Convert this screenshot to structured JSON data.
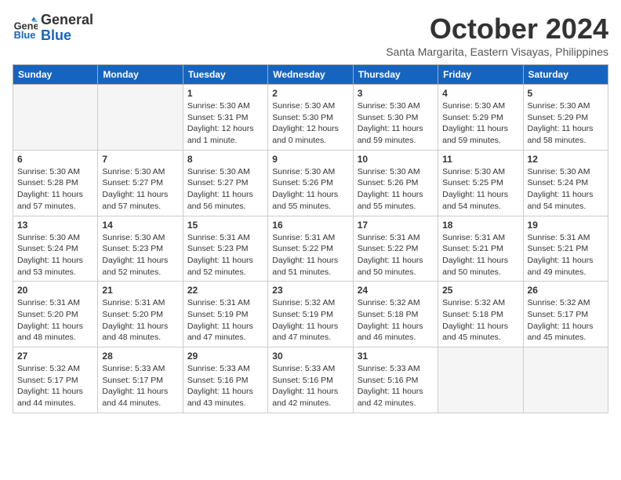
{
  "header": {
    "logo_line1": "General",
    "logo_line2": "Blue",
    "month": "October 2024",
    "location": "Santa Margarita, Eastern Visayas, Philippines"
  },
  "weekdays": [
    "Sunday",
    "Monday",
    "Tuesday",
    "Wednesday",
    "Thursday",
    "Friday",
    "Saturday"
  ],
  "weeks": [
    [
      {
        "day": "",
        "empty": true
      },
      {
        "day": "",
        "empty": true
      },
      {
        "day": "1",
        "sunrise": "5:30 AM",
        "sunset": "5:31 PM",
        "daylight": "12 hours and 1 minute."
      },
      {
        "day": "2",
        "sunrise": "5:30 AM",
        "sunset": "5:30 PM",
        "daylight": "12 hours and 0 minutes."
      },
      {
        "day": "3",
        "sunrise": "5:30 AM",
        "sunset": "5:30 PM",
        "daylight": "11 hours and 59 minutes."
      },
      {
        "day": "4",
        "sunrise": "5:30 AM",
        "sunset": "5:29 PM",
        "daylight": "11 hours and 59 minutes."
      },
      {
        "day": "5",
        "sunrise": "5:30 AM",
        "sunset": "5:29 PM",
        "daylight": "11 hours and 58 minutes."
      }
    ],
    [
      {
        "day": "6",
        "sunrise": "5:30 AM",
        "sunset": "5:28 PM",
        "daylight": "11 hours and 57 minutes."
      },
      {
        "day": "7",
        "sunrise": "5:30 AM",
        "sunset": "5:27 PM",
        "daylight": "11 hours and 57 minutes."
      },
      {
        "day": "8",
        "sunrise": "5:30 AM",
        "sunset": "5:27 PM",
        "daylight": "11 hours and 56 minutes."
      },
      {
        "day": "9",
        "sunrise": "5:30 AM",
        "sunset": "5:26 PM",
        "daylight": "11 hours and 55 minutes."
      },
      {
        "day": "10",
        "sunrise": "5:30 AM",
        "sunset": "5:26 PM",
        "daylight": "11 hours and 55 minutes."
      },
      {
        "day": "11",
        "sunrise": "5:30 AM",
        "sunset": "5:25 PM",
        "daylight": "11 hours and 54 minutes."
      },
      {
        "day": "12",
        "sunrise": "5:30 AM",
        "sunset": "5:24 PM",
        "daylight": "11 hours and 54 minutes."
      }
    ],
    [
      {
        "day": "13",
        "sunrise": "5:30 AM",
        "sunset": "5:24 PM",
        "daylight": "11 hours and 53 minutes."
      },
      {
        "day": "14",
        "sunrise": "5:30 AM",
        "sunset": "5:23 PM",
        "daylight": "11 hours and 52 minutes."
      },
      {
        "day": "15",
        "sunrise": "5:31 AM",
        "sunset": "5:23 PM",
        "daylight": "11 hours and 52 minutes."
      },
      {
        "day": "16",
        "sunrise": "5:31 AM",
        "sunset": "5:22 PM",
        "daylight": "11 hours and 51 minutes."
      },
      {
        "day": "17",
        "sunrise": "5:31 AM",
        "sunset": "5:22 PM",
        "daylight": "11 hours and 50 minutes."
      },
      {
        "day": "18",
        "sunrise": "5:31 AM",
        "sunset": "5:21 PM",
        "daylight": "11 hours and 50 minutes."
      },
      {
        "day": "19",
        "sunrise": "5:31 AM",
        "sunset": "5:21 PM",
        "daylight": "11 hours and 49 minutes."
      }
    ],
    [
      {
        "day": "20",
        "sunrise": "5:31 AM",
        "sunset": "5:20 PM",
        "daylight": "11 hours and 48 minutes."
      },
      {
        "day": "21",
        "sunrise": "5:31 AM",
        "sunset": "5:20 PM",
        "daylight": "11 hours and 48 minutes."
      },
      {
        "day": "22",
        "sunrise": "5:31 AM",
        "sunset": "5:19 PM",
        "daylight": "11 hours and 47 minutes."
      },
      {
        "day": "23",
        "sunrise": "5:32 AM",
        "sunset": "5:19 PM",
        "daylight": "11 hours and 47 minutes."
      },
      {
        "day": "24",
        "sunrise": "5:32 AM",
        "sunset": "5:18 PM",
        "daylight": "11 hours and 46 minutes."
      },
      {
        "day": "25",
        "sunrise": "5:32 AM",
        "sunset": "5:18 PM",
        "daylight": "11 hours and 45 minutes."
      },
      {
        "day": "26",
        "sunrise": "5:32 AM",
        "sunset": "5:17 PM",
        "daylight": "11 hours and 45 minutes."
      }
    ],
    [
      {
        "day": "27",
        "sunrise": "5:32 AM",
        "sunset": "5:17 PM",
        "daylight": "11 hours and 44 minutes."
      },
      {
        "day": "28",
        "sunrise": "5:33 AM",
        "sunset": "5:17 PM",
        "daylight": "11 hours and 44 minutes."
      },
      {
        "day": "29",
        "sunrise": "5:33 AM",
        "sunset": "5:16 PM",
        "daylight": "11 hours and 43 minutes."
      },
      {
        "day": "30",
        "sunrise": "5:33 AM",
        "sunset": "5:16 PM",
        "daylight": "11 hours and 42 minutes."
      },
      {
        "day": "31",
        "sunrise": "5:33 AM",
        "sunset": "5:16 PM",
        "daylight": "11 hours and 42 minutes."
      },
      {
        "day": "",
        "empty": true
      },
      {
        "day": "",
        "empty": true
      }
    ]
  ],
  "labels": {
    "sunrise": "Sunrise:",
    "sunset": "Sunset:",
    "daylight": "Daylight:"
  }
}
